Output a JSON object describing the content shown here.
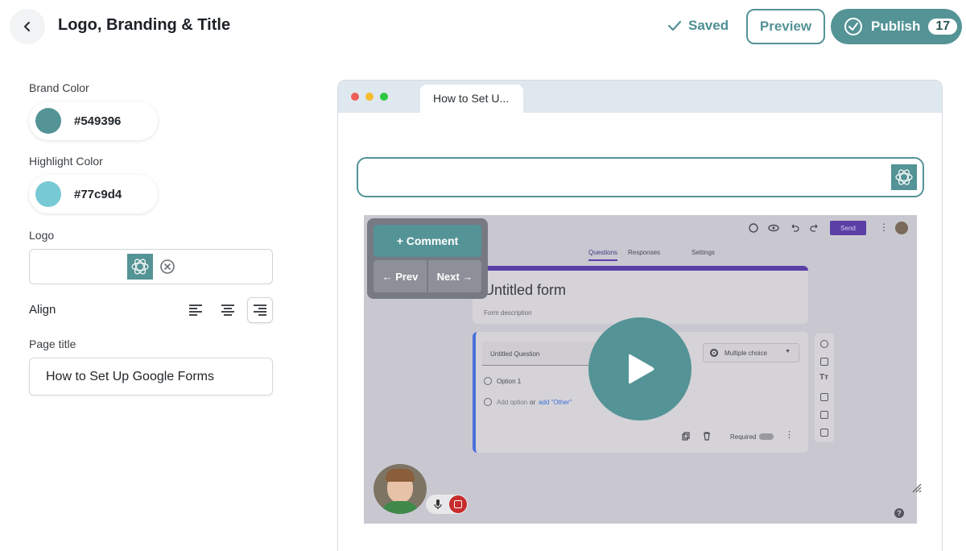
{
  "header": {
    "title": "Logo, Branding & Title",
    "saved_label": "Saved",
    "preview_label": "Preview",
    "publish_label": "Publish",
    "publish_count": "17"
  },
  "branding": {
    "brand_color_label": "Brand Color",
    "brand_color_value": "#549396",
    "highlight_color_label": "Highlight Color",
    "highlight_color_value": "#77c9d4",
    "logo_label": "Logo",
    "align_label": "Align",
    "align_selected": "right",
    "page_title_label": "Page title",
    "page_title_value": "How to Set Up Google Forms"
  },
  "preview": {
    "tab_title": "How to Set U...",
    "overlay": {
      "comment_label": "+ Comment",
      "prev_label": "← Prev",
      "next_label": "Next →"
    },
    "google_form": {
      "send_label": "Send",
      "tabs": [
        "Questions",
        "Responses",
        "Settings"
      ],
      "form_title": "Untitled form",
      "form_description": "Form description",
      "question_placeholder": "Untitled Question",
      "question_type": "Multiple choice",
      "option_1": "Option 1",
      "add_option": "Add option",
      "or_label": "or",
      "add_other": "add \"Other\"",
      "required_label": "Required"
    },
    "help_label": "?"
  },
  "icons": {
    "back": "chevron-left-icon",
    "saved": "check-icon",
    "publish": "check-circle-icon",
    "logo": "flower-logo-icon",
    "remove": "close-circle-icon",
    "play": "play-icon",
    "mic": "mic-icon",
    "stop": "stop-icon"
  },
  "colors": {
    "brand": "#549396",
    "highlight": "#77c9d4",
    "form_accent": "#5b3fa6"
  }
}
